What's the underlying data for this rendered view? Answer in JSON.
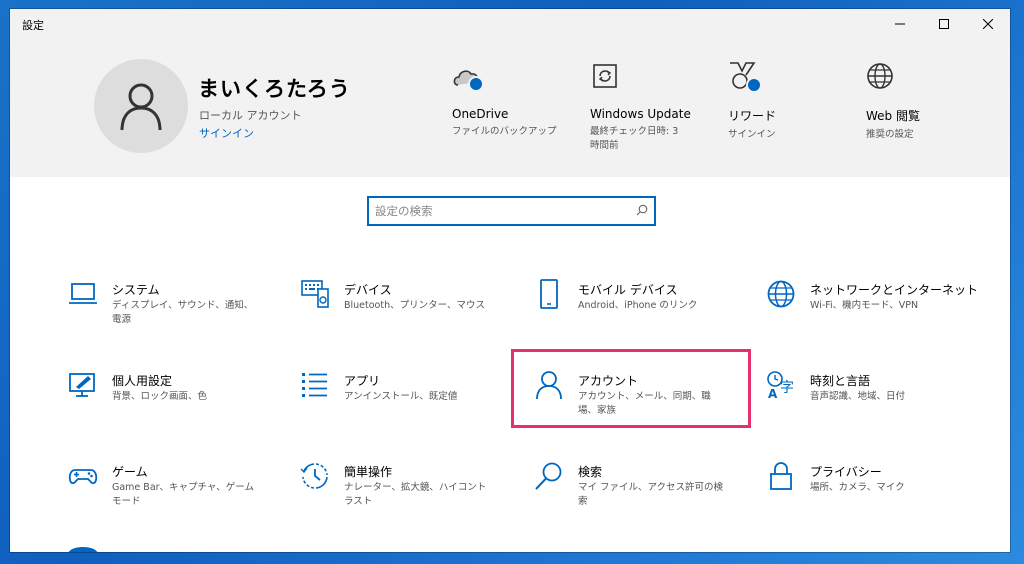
{
  "window": {
    "title": "設定"
  },
  "user": {
    "name": "まいくろたろう",
    "account_type": "ローカル アカウント",
    "signin": "サインイン"
  },
  "header_items": [
    {
      "name": "OneDrive",
      "sub": "ファイルのバックアップ",
      "icon": "cloud-icon"
    },
    {
      "name": "Windows Update",
      "sub": "最終チェック日時: 3 時間前",
      "icon": "sync-icon"
    },
    {
      "name": "リワード",
      "sub": "サインイン",
      "icon": "trophy-icon"
    },
    {
      "name": "Web 閲覧",
      "sub": "推奨の設定",
      "icon": "globe-icon"
    }
  ],
  "search": {
    "placeholder": "設定の検索"
  },
  "categories": [
    {
      "name": "システム",
      "desc": "ディスプレイ、サウンド、通知、電源",
      "icon": "laptop-icon"
    },
    {
      "name": "デバイス",
      "desc": "Bluetooth、プリンター、マウス",
      "icon": "keyboard-icon"
    },
    {
      "name": "モバイル デバイス",
      "desc": "Android、iPhone のリンク",
      "icon": "phone-icon"
    },
    {
      "name": "ネットワークとインターネット",
      "desc": "Wi-Fi、機内モード、VPN",
      "icon": "globe-icon"
    },
    {
      "name": "個人用設定",
      "desc": "背景、ロック画面、色",
      "icon": "paint-icon"
    },
    {
      "name": "アプリ",
      "desc": "アンインストール、既定値",
      "icon": "app-list-icon"
    },
    {
      "name": "アカウント",
      "desc": "アカウント、メール、同期、職場、家族",
      "icon": "person-icon"
    },
    {
      "name": "時刻と言語",
      "desc": "音声認識、地域、日付",
      "icon": "time-language-icon"
    },
    {
      "name": "ゲーム",
      "desc": "Game Bar、キャプチャ、ゲーム モード",
      "icon": "gamepad-icon"
    },
    {
      "name": "簡単操作",
      "desc": "ナレーター、拡大鏡、ハイコントラスト",
      "icon": "ease-of-access-icon"
    },
    {
      "name": "検索",
      "desc": "マイ ファイル、アクセス許可の検索",
      "icon": "search-icon"
    },
    {
      "name": "プライバシー",
      "desc": "場所、カメラ、マイク",
      "icon": "lock-icon"
    }
  ],
  "colors": {
    "accent": "#0067c0",
    "highlight": "#e6306c",
    "header_bg": "#f2f2f2"
  }
}
